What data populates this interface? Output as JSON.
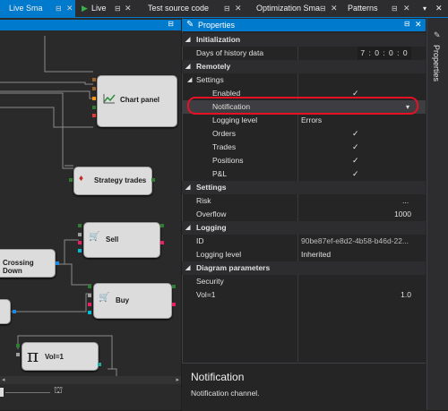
{
  "tabs": [
    {
      "label": "Live Sma",
      "active": true
    },
    {
      "label": "Live",
      "active": false
    },
    {
      "label": "Test source code",
      "active": false
    },
    {
      "label": "Optimization Sma",
      "active": false
    },
    {
      "label": "Patterns",
      "active": false
    }
  ],
  "canvas": {
    "nodes": {
      "chart_panel": "Chart panel",
      "strategy_trades": "Strategy trades",
      "sell": "Sell",
      "crossing_down": "Crossing Down",
      "buy": "Buy",
      "vol": "Vol=1"
    }
  },
  "properties": {
    "title": "Properties",
    "sections": {
      "initialization": "Initialization",
      "remotely": "Remotely",
      "settings": "Settings",
      "logging": "Logging",
      "diagram_parameters": "Diagram parameters"
    },
    "rows": {
      "days_of_history": {
        "label": "Days of history data",
        "value": "7 : 0 : 0 : 0"
      },
      "settings_group": {
        "label": "Settings"
      },
      "enabled": {
        "label": "Enabled",
        "checked": true
      },
      "notification": {
        "label": "Notification",
        "value": ""
      },
      "logging_level_remote": {
        "label": "Logging level",
        "value": "Errors"
      },
      "orders": {
        "label": "Orders",
        "checked": true
      },
      "trades": {
        "label": "Trades",
        "checked": true
      },
      "positions": {
        "label": "Positions",
        "checked": true
      },
      "pnl": {
        "label": "P&L",
        "checked": true
      },
      "risk": {
        "label": "Risk",
        "value": "..."
      },
      "overflow": {
        "label": "Overflow",
        "value": "1000"
      },
      "id": {
        "label": "ID",
        "value": "90be87ef-e8d2-4b58-b46d-22..."
      },
      "logging_level": {
        "label": "Logging level",
        "value": "Inherited"
      },
      "security": {
        "label": "Security",
        "value": ""
      },
      "vol1": {
        "label": "Vol=1",
        "value": "1.0"
      }
    },
    "description": {
      "title": "Notification",
      "text": "Notification channel."
    }
  },
  "side_tab": "Properties",
  "colors": {
    "accent": "#007acc",
    "highlight": "#e81123"
  }
}
